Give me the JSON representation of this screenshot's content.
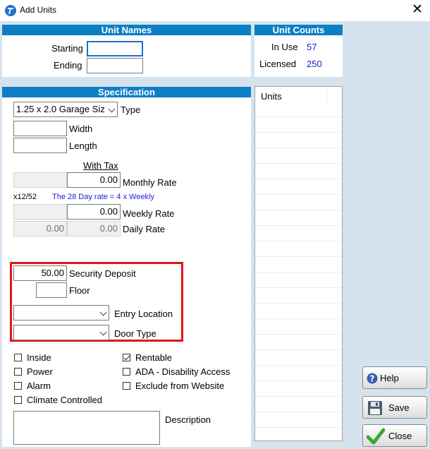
{
  "window": {
    "title": "Add Units",
    "close_glyph": "✕"
  },
  "unit_names": {
    "header": "Unit Names",
    "starting_label": "Starting",
    "starting_value": "",
    "ending_label": "Ending",
    "ending_value": ""
  },
  "unit_counts": {
    "header": "Unit Counts",
    "in_use_label": "In Use",
    "in_use_value": "57",
    "licensed_label": "Licensed",
    "licensed_value": "250"
  },
  "specification": {
    "header": "Specification",
    "type_value": "1.25 x 2.0 Garage Siz",
    "type_label": "Type",
    "width_label": "Width",
    "width_value": "",
    "length_label": "Length",
    "length_value": "",
    "with_tax_label": "With Tax",
    "monthly_rate_value": "0.00",
    "monthly_rate_label": "Monthly Rate",
    "x12_label": "x12/52",
    "note_28day": "The 28 Day rate = 4 x Weekly",
    "weekly_rate_value": "0.00",
    "weekly_rate_label": "Weekly Rate",
    "daily_rate_value": "0.00",
    "daily_rate_tax_value": "0.00",
    "daily_rate_label": "Daily Rate",
    "security_deposit_value": "50.00",
    "security_deposit_label": "Security Deposit",
    "floor_value": "",
    "floor_label": "Floor",
    "entry_location_value": "",
    "entry_location_label": "Entry Location",
    "door_type_value": "",
    "door_type_label": "Door Type",
    "description_label": "Description",
    "description_value": ""
  },
  "checkboxes": {
    "inside": {
      "label": "Inside",
      "checked": false
    },
    "power": {
      "label": "Power",
      "checked": false
    },
    "alarm": {
      "label": "Alarm",
      "checked": false
    },
    "climate": {
      "label": "Climate Controlled",
      "checked": false
    },
    "rentable": {
      "label": "Rentable",
      "checked": true
    },
    "ada": {
      "label": "ADA - Disability Access",
      "checked": false
    },
    "exclude": {
      "label": "Exclude from Website",
      "checked": false
    }
  },
  "units_list": {
    "header": "Units"
  },
  "buttons": {
    "help": "Help",
    "save": "Save",
    "close": "Close"
  },
  "colors": {
    "header_blue": "#0c7fc4",
    "window_bg": "#d5e3ee",
    "highlight_red": "#e1141c",
    "link_blue": "#1a1ad6"
  }
}
